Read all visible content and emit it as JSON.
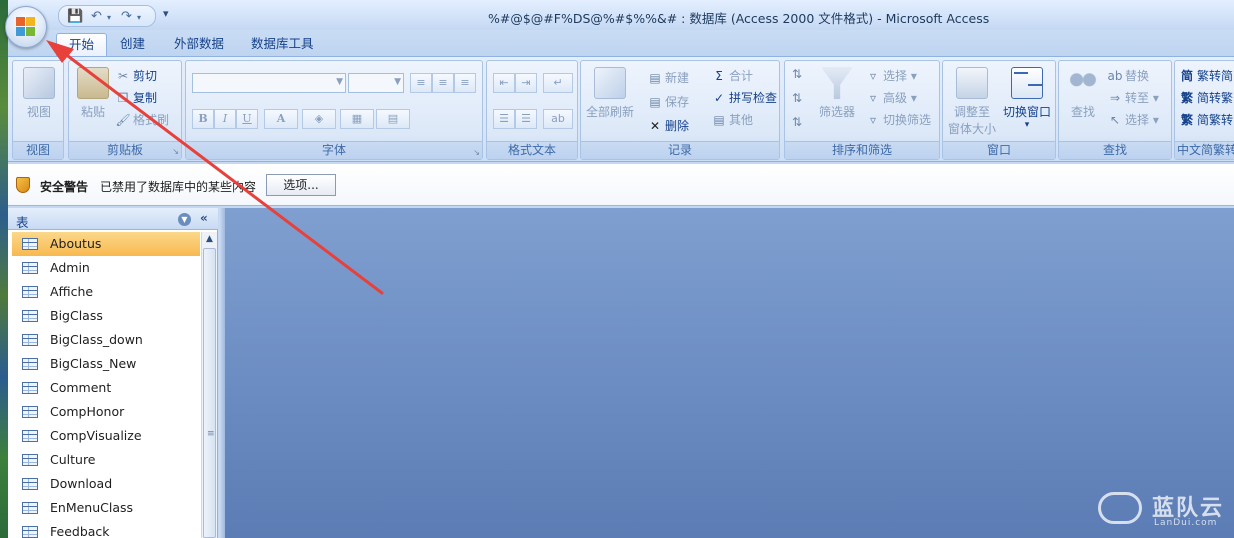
{
  "window": {
    "title": "%#@$@#F%DS@%#$%%&# : 数据库 (Access 2000 文件格式) - Microsoft Access"
  },
  "quick_access": {
    "save_icon": "save-icon",
    "undo_icon": "undo-icon",
    "redo_icon": "redo-icon",
    "more": "▾"
  },
  "tabs": [
    {
      "label": "开始",
      "active": true
    },
    {
      "label": "创建",
      "active": false
    },
    {
      "label": "外部数据",
      "active": false
    },
    {
      "label": "数据库工具",
      "active": false
    }
  ],
  "ribbon": {
    "view_group": {
      "button": "视图",
      "label": "视图"
    },
    "clipboard": {
      "paste": "粘贴",
      "cut": "剪切",
      "copy": "复制",
      "format_painter": "格式刷",
      "label": "剪贴板"
    },
    "font": {
      "label": "字体",
      "bold": "B",
      "italic": "I",
      "underline": "U",
      "font_color": "A"
    },
    "rich_text": {
      "label": "格式文本"
    },
    "records": {
      "refresh_all": "全部刷新",
      "new": "新建",
      "save": "保存",
      "delete": "删除",
      "totals": "合计",
      "spelling": "拼写检查",
      "more": "其他",
      "label": "记录"
    },
    "sort_filter": {
      "filter": "筛选器",
      "selection": "选择",
      "advanced": "高级",
      "toggle_filter": "切换筛选",
      "label": "排序和筛选"
    },
    "window": {
      "size_to_fit_line1": "调整至",
      "size_to_fit_line2": "窗体大小",
      "switch_windows": "切换窗口",
      "label": "窗口"
    },
    "find": {
      "find": "查找",
      "replace": "替换",
      "goto": "转至",
      "select": "选择",
      "label": "查找"
    },
    "chinese": {
      "to_simplified": "繁转简",
      "to_traditional": "简转繁",
      "convert": "简繁转",
      "label": "中文简繁转"
    }
  },
  "message_bar": {
    "title": "安全警告",
    "text": "已禁用了数据库中的某些内容",
    "button": "选项..."
  },
  "nav_pane": {
    "title": "表",
    "items": [
      {
        "label": "Aboutus",
        "selected": true
      },
      {
        "label": "Admin",
        "selected": false
      },
      {
        "label": "Affiche",
        "selected": false
      },
      {
        "label": "BigClass",
        "selected": false
      },
      {
        "label": "BigClass_down",
        "selected": false
      },
      {
        "label": "BigClass_New",
        "selected": false
      },
      {
        "label": "Comment",
        "selected": false
      },
      {
        "label": "CompHonor",
        "selected": false
      },
      {
        "label": "CompVisualize",
        "selected": false
      },
      {
        "label": "Culture",
        "selected": false
      },
      {
        "label": "Download",
        "selected": false
      },
      {
        "label": "EnMenuClass",
        "selected": false
      },
      {
        "label": "Feedback",
        "selected": false
      }
    ]
  },
  "watermark": {
    "title": "蓝队云",
    "subtitle": "LanDui.com"
  },
  "colors": {
    "selection": "#f8b94f",
    "workspace": "#6b8cc2",
    "arrow": "#e8403a"
  }
}
